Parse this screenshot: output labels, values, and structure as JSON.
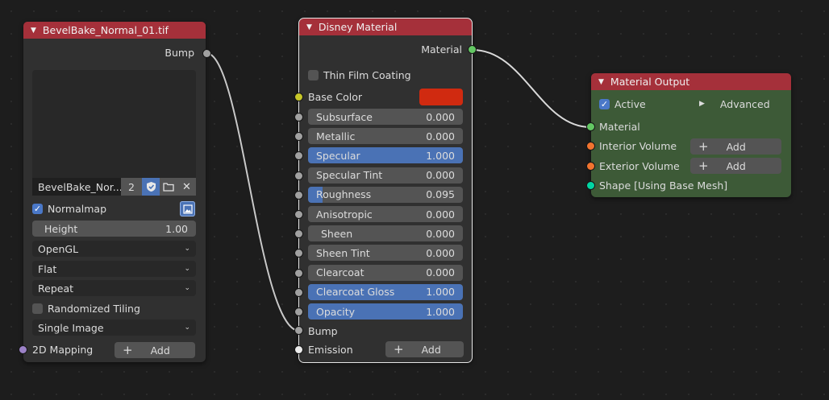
{
  "image_node": {
    "title": "BevelBake_Normal_01.tif",
    "output_bump": "Bump",
    "image_name": "BevelBake_Nor...",
    "user_count": "2",
    "normalmap_label": "Normalmap",
    "height_label": "Height",
    "height_value": "1.00",
    "space_option": "OpenGL",
    "interpolation_option": "Flat",
    "extension_option": "Repeat",
    "randomized_tiling_label": "Randomized Tiling",
    "source_option": "Single Image",
    "mapping_label": "2D Mapping",
    "add_label": "Add"
  },
  "disney_node": {
    "title": "Disney Material",
    "output_material": "Material",
    "thin_film_label": "Thin Film Coating",
    "base_color_label": "Base Color",
    "base_color_hex": "#d02a10",
    "params": [
      {
        "label": "Subsurface",
        "value": "0.000",
        "fill": 0
      },
      {
        "label": "Metallic",
        "value": "0.000",
        "fill": 0
      },
      {
        "label": "Specular",
        "value": "1.000",
        "fill": 1
      },
      {
        "label": "Specular Tint",
        "value": "0.000",
        "fill": 0
      },
      {
        "label": "Roughness",
        "value": "0.095",
        "fill": 0.095
      },
      {
        "label": "Anisotropic",
        "value": "0.000",
        "fill": 0
      },
      {
        "label": "Sheen",
        "value": "0.000",
        "fill": 0
      },
      {
        "label": "Sheen Tint",
        "value": "0.000",
        "fill": 0
      },
      {
        "label": "Clearcoat",
        "value": "0.000",
        "fill": 0
      },
      {
        "label": "Clearcoat Gloss",
        "value": "1.000",
        "fill": 1
      },
      {
        "label": "Opacity",
        "value": "1.000",
        "fill": 1
      }
    ],
    "bump_label": "Bump",
    "emission_label": "Emission",
    "add_label": "Add"
  },
  "output_node": {
    "title": "Material Output",
    "active_label": "Active",
    "advanced_label": "Advanced",
    "material_label": "Material",
    "interior_label": "Interior Volume",
    "exterior_label": "Exterior Volume",
    "add_label": "Add",
    "shape_label": "Shape [Using Base Mesh]"
  },
  "colors": {
    "header_red": "#a5303a",
    "output_body_green": "#3d5a37",
    "slider_blue": "#4a72b5"
  }
}
